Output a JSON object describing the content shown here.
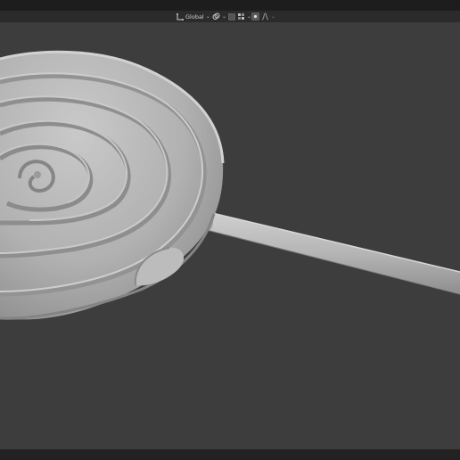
{
  "header": {
    "transform_orientation": {
      "label": "Global",
      "icon": "transform-orientation-icon"
    },
    "snapping": {
      "icon": "link-icon"
    },
    "proportional_editing": {
      "icon": "proportional-edit-icon",
      "falloff_icon": "falloff-curve-icon"
    }
  },
  "viewport": {
    "object": "lollipop-mesh",
    "background": "#3d3d3d",
    "mesh_color": "#b3b3b3"
  }
}
